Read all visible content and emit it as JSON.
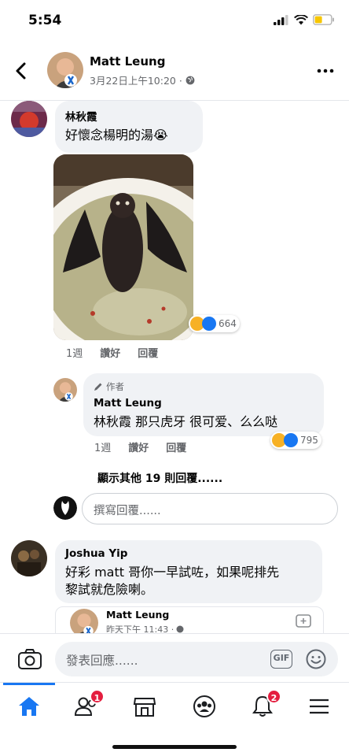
{
  "status_bar": {
    "time": "5:54"
  },
  "header": {
    "name": "Matt Leung",
    "timestamp": "3月22日上午10:20 ·"
  },
  "comments": [
    {
      "name": "林秋霞",
      "text": "好懷念楊明的湯😭",
      "age": "1週",
      "like_label": "讚好",
      "reply_label": "回覆",
      "reaction_count": "664"
    }
  ],
  "reply": {
    "badge": "作者",
    "name": "Matt Leung",
    "text": "林秋霞 那只虎牙 很可爱、么么哒",
    "age": "1週",
    "like_label": "讚好",
    "reply_label": "回覆",
    "reaction_count": "795"
  },
  "more_replies_label": "顯示其他 19 則回覆......",
  "reply_input_placeholder": "撰寫回覆......",
  "comment2": {
    "name": "Joshua Yip",
    "text_line1": "好彩 matt 哥你一早試咗，如果呢排先",
    "text_line2": "黎試就危險喇。"
  },
  "embed": {
    "name": "Matt Leung",
    "timestamp": "昨天下午 11:43 ·"
  },
  "composer": {
    "placeholder": "發表回應......",
    "gif_label": "GIF"
  },
  "tabbar": {
    "friends_badge": "1",
    "notifications_badge": "2"
  },
  "colors": {
    "accent": "#1877f2",
    "badge": "#e41e3f",
    "bubble": "#f0f2f5",
    "secondary_text": "#65676b"
  }
}
